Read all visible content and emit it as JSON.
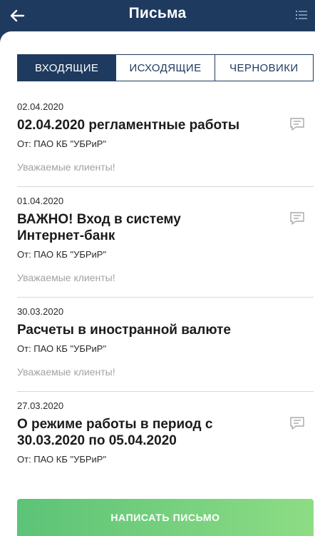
{
  "header": {
    "title": "Письма",
    "back_icon": "arrow-left-icon",
    "menu_icon": "list-icon"
  },
  "tabs": [
    {
      "label": "ВХОДЯЩИЕ",
      "active": true
    },
    {
      "label": "ИСХОДЯЩИЕ",
      "active": false
    },
    {
      "label": "ЧЕРНОВИКИ",
      "active": false
    }
  ],
  "messages": [
    {
      "date": "02.04.2020",
      "subject": "02.04.2020 регламентные работы",
      "from": "От: ПАО КБ \"УБРиР\"",
      "preview": "Уважаемые клиенты!",
      "icon": "message-icon"
    },
    {
      "date": "01.04.2020",
      "subject": "ВАЖНО! Вход в систему Интернет-банк",
      "from": "От: ПАО КБ \"УБРиР\"",
      "preview": "Уважаемые клиенты!",
      "icon": "message-icon"
    },
    {
      "date": "30.03.2020",
      "subject": "Расчеты в иностранной валюте",
      "from": "От: ПАО КБ \"УБРиР\"",
      "preview": "Уважаемые клиенты!",
      "icon": ""
    },
    {
      "date": "27.03.2020",
      "subject": "О режиме работы в период с 30.03.2020 по 05.04.2020",
      "from": "От: ПАО КБ \"УБРиР\"",
      "preview": "",
      "icon": "message-icon"
    }
  ],
  "compose_button": {
    "label": "НАПИСАТЬ ПИСЬМО"
  },
  "colors": {
    "brand": "#1f3a5f",
    "accent": "#5cc377"
  }
}
